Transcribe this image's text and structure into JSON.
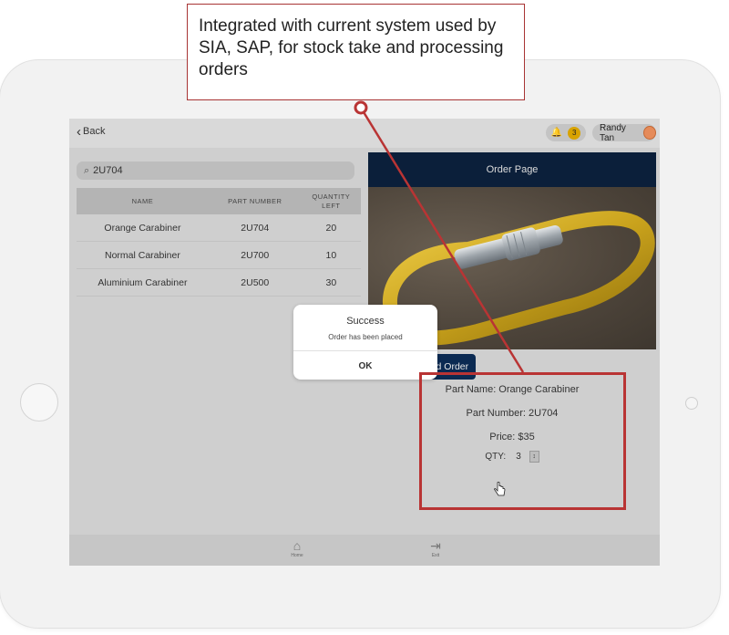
{
  "callout": {
    "text": "Integrated with current system used by SIA, SAP, for stock take and processing orders"
  },
  "topbar": {
    "back_label": "Back",
    "notification_count": "3",
    "user_name": "Randy Tan"
  },
  "search": {
    "value": "2U704"
  },
  "table": {
    "headers": [
      "NAME",
      "PART NUMBER",
      "QUANTITY LEFT"
    ],
    "rows": [
      {
        "name": "Orange Carabiner",
        "part": "2U704",
        "qty": "20"
      },
      {
        "name": "Normal Carabiner",
        "part": "2U700",
        "qty": "10"
      },
      {
        "name": "Aluminium Carabiner",
        "part": "2U500",
        "qty": "30"
      }
    ]
  },
  "order": {
    "header": "Order Page",
    "part_name": "Part Name: Orange Carabiner",
    "part_number": "Part Number: 2U704",
    "price": "Price: $35",
    "qty_label": "QTY:",
    "qty_value": "3",
    "send_label": "Send Order"
  },
  "modal": {
    "title": "Success",
    "message": "Order has been placed",
    "ok_label": "OK"
  },
  "bottom_nav": {
    "home_label": "Home",
    "exit_label": "Exit"
  },
  "colors": {
    "accent_navy": "#0b1f3a",
    "highlight_red": "#b93434",
    "badge_gold": "#d8a300"
  }
}
